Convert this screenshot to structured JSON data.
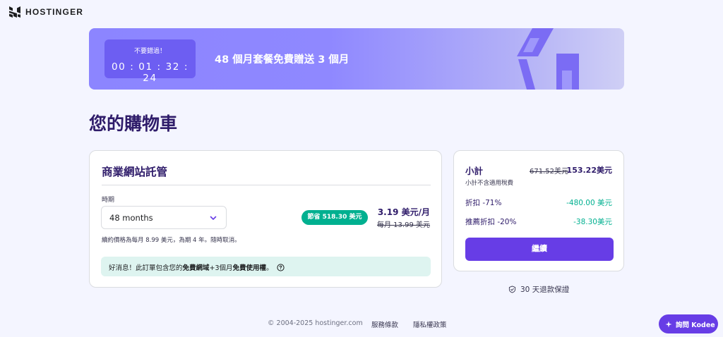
{
  "brand": {
    "name": "HOSTINGER",
    "icon": "hostinger-logo-icon"
  },
  "colors": {
    "primary": "#673de6",
    "banner": "#8c85ff",
    "timer_bg": "#6d5ef2",
    "success": "#00b090",
    "title": "#2f1c6a",
    "page_bg": "#f4f5ff"
  },
  "banner": {
    "timer_label": "不要錯過！",
    "timer_value": "00 : 01 : 32 : 24",
    "headline": "48 個月套餐免費贈送 3 個月"
  },
  "page_title": "您的購物車",
  "cart_item": {
    "title": "商業網站託管",
    "period_label": "時期",
    "period_value": "48 months",
    "save_badge": "節省 518.30 美元",
    "price": "3.19 美元/月",
    "old_price": "每月 13.99 美元",
    "renewal_note": "續約價格為每月 8.99 美元，為期 4 年。隨時取消。",
    "good_news_prefix": "好消息！此訂單包含您的",
    "good_news_bold_1": "免費網域",
    "good_news_middle": "+3個月",
    "good_news_bold_2": "免費使用權",
    "good_news_suffix": "。"
  },
  "summary": {
    "subtotal_label": "小計",
    "subtotal_old": "671.52美元",
    "subtotal_new": "153.22美元",
    "tax_note": "小計不含適用稅費",
    "discount_label": "折扣 -71%",
    "discount_value": "-480.00 美元",
    "referral_label": "推薦折扣 -20%",
    "referral_value": "-38.30美元",
    "continue_label": "繼續"
  },
  "guarantee": "30 天退款保證",
  "footer": {
    "copyright": "© 2004-2025 hostinger.com",
    "terms": "服務條款",
    "privacy": "隱私權政策"
  },
  "kodee_label": "詢問 Kodee"
}
